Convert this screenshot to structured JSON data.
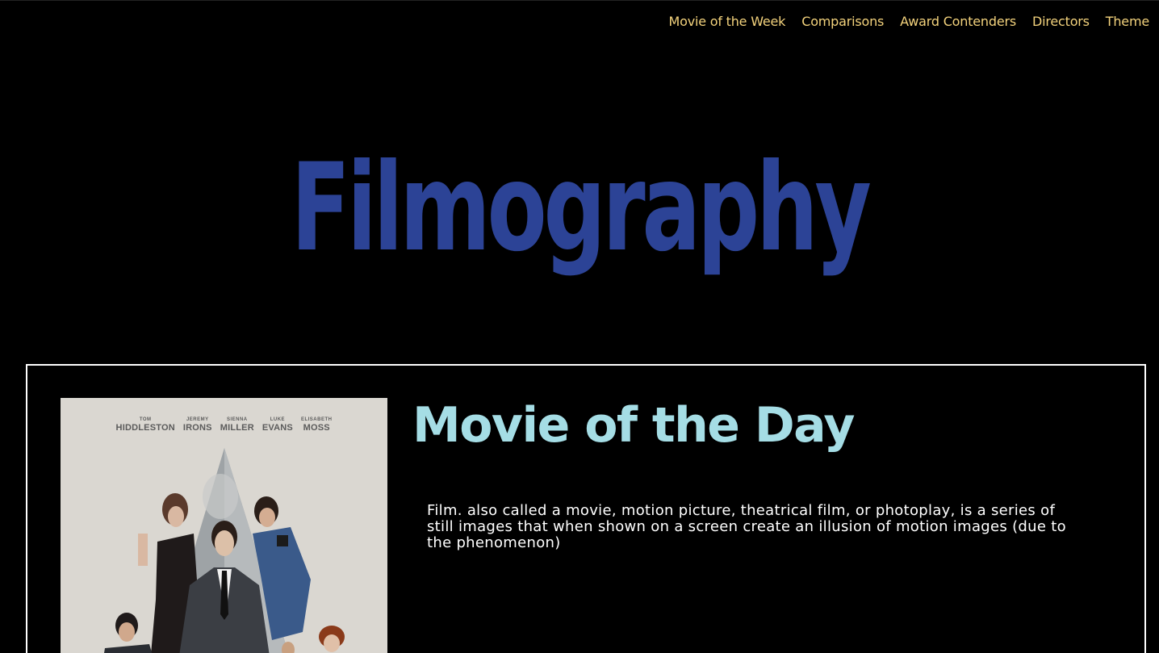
{
  "nav": {
    "items": [
      {
        "label": "Movie of the Week"
      },
      {
        "label": "Comparisons"
      },
      {
        "label": "Award Contenders"
      },
      {
        "label": "Directors"
      },
      {
        "label": "Theme"
      }
    ]
  },
  "hero": {
    "title": "Filmography"
  },
  "movie_of_the_day": {
    "title": "Movie of the Day",
    "description": "Film. also called a movie, motion picture, theatrical film, or photoplay, is a series of still images that when shown on a screen create an illusion of motion images (due to the phenomenon)",
    "poster": {
      "cast": [
        {
          "first": "TOM",
          "last": "HIDDLESTON"
        },
        {
          "first": "JEREMY",
          "last": "IRONS"
        },
        {
          "first": "SIENNA",
          "last": "MILLER"
        },
        {
          "first": "LUKE",
          "last": "EVANS"
        },
        {
          "first": "ELISABETH",
          "last": "MOSS"
        }
      ]
    }
  },
  "colors": {
    "background": "#000000",
    "nav_link": "#f3d27c",
    "hero_title": "#2c4396",
    "card_title": "#a5dde5",
    "card_border": "#ffffff",
    "poster_bg": "#dad7d1"
  }
}
